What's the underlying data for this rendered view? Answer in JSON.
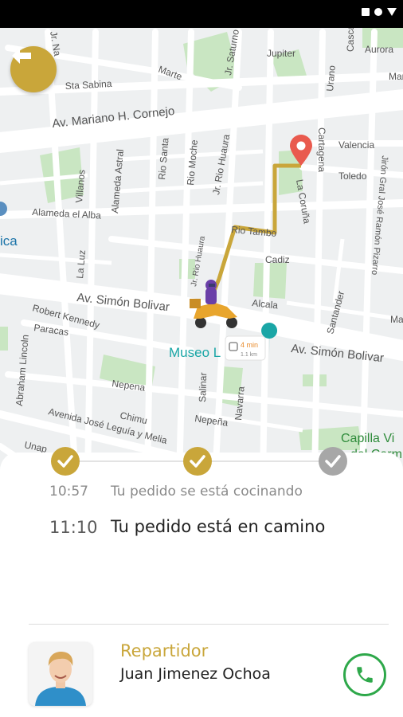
{
  "map": {
    "streets": [
      "Av. Mariano H. Cornejo",
      "Av. Simón Bolivar",
      "Av. Simón Bolivar",
      "Sta Sabina",
      "Marte",
      "Jr. Saturno",
      "Jupiter",
      "Urano",
      "Aurora",
      "Cascabe",
      "Valencia",
      "Toledo",
      "Cartagena",
      "La Coruña",
      "Jirón Gral José Ramón Pizarro",
      "Villanos",
      "Alameda Astral",
      "Alameda el Alba",
      "La Luz",
      "Rio Santa",
      "Rio Moche",
      "Jr. Rio Huaura",
      "Jr. Rio Huaura",
      "Rio Tambo",
      "Cadiz",
      "Alcala",
      "Santander",
      "Robert Kennedy",
      "Paracas",
      "Abraham Lincoln",
      "Nepena",
      "Chimu",
      "Avenida José Leguía y Melia",
      "Unap",
      "Salinar",
      "Nepeña",
      "Navarra",
      "Jr. Na",
      "Mar"
    ],
    "poi_museo": "Museo L",
    "poi_capilla": "Capilla Vi",
    "poi_capilla_line2": "del Carm",
    "poi_left": "ica",
    "eta_time": "4 min",
    "eta_distance": "1.1 km"
  },
  "progress": {
    "steps": [
      "done",
      "done",
      "pending"
    ],
    "events": [
      {
        "time": "10:57",
        "text": "Tu pedido se está cocinando"
      },
      {
        "time": "11:10",
        "text": "Tu pedido está en camino"
      }
    ]
  },
  "courier": {
    "role": "Repartidor",
    "name": "Juan Jimenez Ochoa"
  },
  "icons": {
    "back": "arrow-left-icon",
    "check": "check-icon",
    "phone": "phone-icon",
    "pin": "location-pin-icon",
    "rider": "delivery-scooter-icon"
  },
  "colors": {
    "accent": "#c9a63a",
    "pending": "#a7a7a7",
    "call": "#2ea84a",
    "route": "#c9a63a",
    "pin": "#e95a4e"
  }
}
